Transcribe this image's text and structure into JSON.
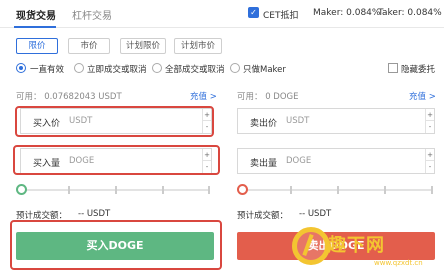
{
  "tabs": [
    "现货交易",
    "杠杆交易"
  ],
  "cet": {
    "label": "CET抵扣",
    "checked": true
  },
  "fees": {
    "maker": "Maker: 0.084%",
    "taker": "Taker: 0.084%"
  },
  "order_types": [
    "限价",
    "市价",
    "计划限价",
    "计划市价"
  ],
  "active_order_type": "限价",
  "time_in_force": [
    "一直有效",
    "立即成交或取消",
    "全部成交或取消",
    "只做Maker"
  ],
  "selected_tif": "一直有效",
  "hidden_order": "隐藏委托",
  "buy": {
    "available": "可用：  0.07682043 USDT",
    "recharge": "充值 >",
    "price_label": "买入价",
    "price_unit": "USDT",
    "amount_label": "买入量",
    "amount_unit": "DOGE",
    "est_label": "预计成交额：",
    "est_value": "-- USDT",
    "button": "买入DOGE",
    "color": "#5eb782"
  },
  "sell": {
    "available": "可用：  0 DOGE",
    "recharge": "充值 >",
    "price_label": "卖出价",
    "price_unit": "USDT",
    "amount_label": "卖出量",
    "amount_unit": "DOGE",
    "est_label": "预计成交额：",
    "est_value": "-- USDT",
    "button": "卖出DOGE",
    "color": "#e35e4c"
  },
  "stepper": {
    "up": "+",
    "down": "-"
  },
  "watermark": {
    "text": "趣下网",
    "url": "www.qzxdt.cn"
  },
  "colors": {
    "accent": "#2f6fdb",
    "highlight": "#d9473f"
  }
}
